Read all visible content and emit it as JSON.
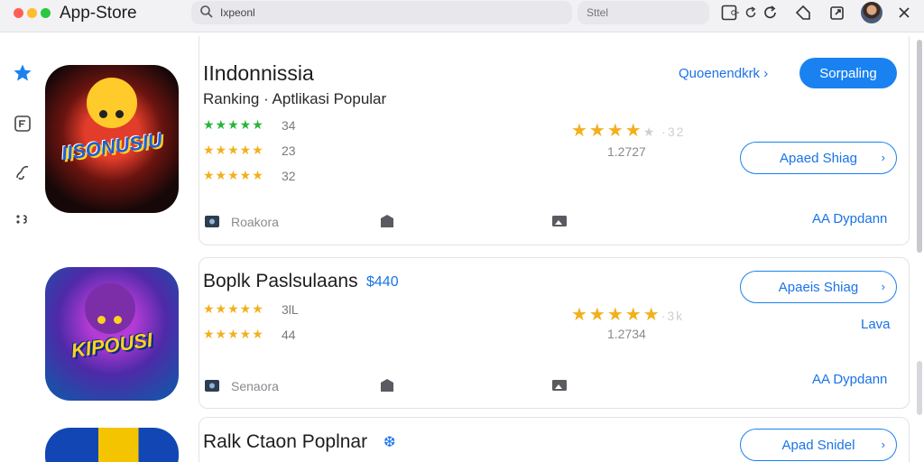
{
  "window": {
    "title": "App-Store",
    "search": {
      "value": "Ixpeonl"
    },
    "search2": {
      "placeholder": "Sttel"
    },
    "toolbar_icons": [
      "square-icon",
      "refresh-icon",
      "tag-icon",
      "share-icon",
      "profile-avatar",
      "close-icon"
    ]
  },
  "sidebar": {
    "items": [
      {
        "icon": "star-icon",
        "active": true
      },
      {
        "icon": "document-icon"
      },
      {
        "icon": "paint-icon"
      },
      {
        "icon": "grid-icon"
      }
    ]
  },
  "apps": [
    {
      "title": "IIndonnissia",
      "subtitle": "Ranking · Aptlikasi Popular",
      "ratings": [
        {
          "stars": "★★★★★",
          "count": "34",
          "color": "green"
        },
        {
          "stars": "★★★★★",
          "count": "23",
          "color": "gold"
        },
        {
          "stars": "★★★★★",
          "count": "32",
          "color": "gold"
        }
      ],
      "rating_score": "★★★★",
      "rating_half": "★ ·32",
      "rating_value": "1.2727",
      "developer": "Roakora",
      "header_link": "Quoenendkrk",
      "header_link_chevron": "›",
      "primary_button": "Sorpaling",
      "secondary_button": "Apaed Shiag",
      "footer_link": "AA Dypdann",
      "icon_text": "IISONUSIU",
      "badge": ""
    },
    {
      "title": "Boplk Paslsulaans",
      "badge": "$440",
      "ratings": [
        {
          "stars": "★★★★★",
          "count": "3lL",
          "color": "gold"
        },
        {
          "stars": "★★★★★",
          "count": "44",
          "color": "gold"
        }
      ],
      "rating_score": "★★★★★",
      "rating_half": "·3k",
      "rating_value": "1.2734",
      "developer": "Senaora",
      "secondary_button": "Apaeis Shiag",
      "tag": "Lava",
      "footer_link": "AA Dypdann",
      "icon_text": "KIPOUSI"
    },
    {
      "title": "Ralk Ctaon Poplnar",
      "badge": "❆",
      "secondary_button": "Apad Snidel"
    }
  ],
  "colors": {
    "accent": "#1a82f0",
    "star_gold": "#f2b01e",
    "star_green": "#27b53a"
  }
}
